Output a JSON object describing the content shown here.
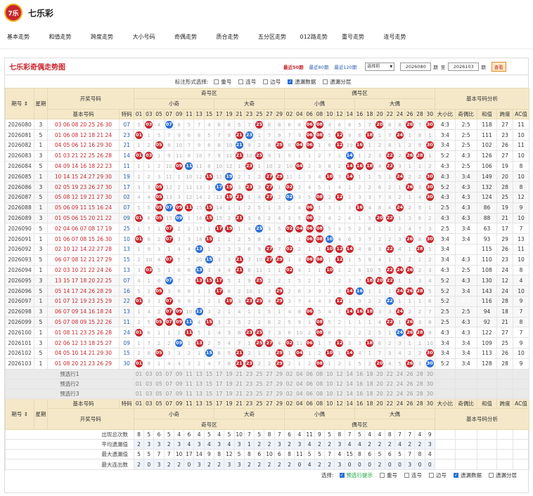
{
  "site": {
    "title": "七乐彩",
    "logo": "7乐"
  },
  "nav": [
    "基本走势",
    "和值走势",
    "跨度走势",
    "大小号码",
    "奇偶走势",
    "质合走势",
    "五分区走势",
    "012路走势",
    "重号走势",
    "连号走势"
  ],
  "panel": {
    "title": "七乐彩奇偶走势图",
    "tabs": [
      "最近50期",
      "最近80期",
      "最近120期"
    ],
    "select": "选择前",
    "from": "2026080",
    "to": "2026103",
    "period": "期",
    "sep": "至",
    "query": "查看"
  },
  "options": {
    "label": "标注形式选择:",
    "items": [
      {
        "l": "重号",
        "on": false
      },
      {
        "l": "连号",
        "on": false
      },
      {
        "l": "边号",
        "on": false
      },
      {
        "l": "遗漏数据",
        "on": true
      },
      {
        "l": "遗漏分层",
        "on": false
      }
    ]
  },
  "header": {
    "issue": "期号",
    "week": "星期",
    "kj": "开奖号码",
    "jz": "奇号区",
    "oz": "偶号区",
    "an": "基本号码分析",
    "basic": "基本号码",
    "special": "特码",
    "xq": "小奇",
    "dq": "大奇",
    "xo": "小偶",
    "do": "大偶",
    "analysis": [
      "大小比",
      "奇偶比",
      "和值",
      "跨度",
      "AC值"
    ]
  },
  "odd": [
    "01",
    "03",
    "05",
    "07",
    "09",
    "11",
    "13",
    "15",
    "17",
    "19",
    "21",
    "23",
    "25",
    "27",
    "29"
  ],
  "even": [
    "02",
    "04",
    "06",
    "08",
    "10",
    "12",
    "14",
    "16",
    "18",
    "20",
    "22",
    "24",
    "26",
    "28",
    "30"
  ],
  "rows": [
    {
      "i": "2026080",
      "w": "3",
      "n": "03 06 08 20 25 26 30",
      "s": "07",
      "a": [
        "4:3",
        "2:5",
        "118",
        "27",
        "11"
      ]
    },
    {
      "i": "2026081",
      "w": "5",
      "n": "01 06 08 12 18 21 24",
      "s": "23",
      "a": [
        "3:4",
        "2:5",
        "111",
        "23",
        "10"
      ]
    },
    {
      "i": "2026082",
      "w": "1",
      "n": "04 05 06 12 16 29 30",
      "s": "21",
      "a": [
        "3:4",
        "2:5",
        "102",
        "26",
        "11"
      ]
    },
    {
      "i": "2026083",
      "w": "3",
      "n": "01 03 21 22 25 26 28",
      "s": "14",
      "a": [
        "5:2",
        "4:3",
        "126",
        "27",
        "10"
      ]
    },
    {
      "i": "2026084",
      "w": "5",
      "n": "04 09 14 16 18 22 23",
      "s": "11",
      "a": [
        "4:3",
        "2:5",
        "106",
        "19",
        "8"
      ]
    },
    {
      "i": "2026085",
      "w": "1",
      "n": "10 14 15 24 27 29 30",
      "s": "19",
      "a": [
        "4:3",
        "3:4",
        "149",
        "20",
        "10"
      ]
    },
    {
      "i": "2026086",
      "w": "3",
      "n": "02 05 19 23 26 27 30",
      "s": "17",
      "a": [
        "5:2",
        "4:3",
        "132",
        "28",
        "8"
      ]
    },
    {
      "i": "2026087",
      "w": "5",
      "n": "05 08 12 19 21 27 30",
      "s": "02",
      "a": [
        "4:3",
        "4:3",
        "124",
        "25",
        "12"
      ]
    },
    {
      "i": "2026088",
      "w": "1",
      "n": "05 06 09 11 15 16 24",
      "s": "07",
      "a": [
        "2:5",
        "4:3",
        "86",
        "19",
        "9"
      ]
    },
    {
      "i": "2026089",
      "w": "3",
      "n": "01 05 06 15 20 21 22",
      "s": "09",
      "a": [
        "4:3",
        "4:3",
        "88",
        "21",
        "10"
      ]
    },
    {
      "i": "2026090",
      "w": "5",
      "n": "02 04 06 07 08 17 19",
      "s": "25",
      "a": [
        "2:5",
        "3:4",
        "63",
        "17",
        "7"
      ]
    },
    {
      "i": "2026091",
      "w": "1",
      "n": "01 06 07 08 15 26 30",
      "s": "10",
      "a": [
        "3:4",
        "3:4",
        "93",
        "29",
        "13"
      ]
    },
    {
      "i": "2026092",
      "w": "3",
      "n": "02 10 12 14 22 27 28",
      "s": "13",
      "a": [
        "3:4",
        "1:6",
        "115",
        "26",
        "11"
      ]
    },
    {
      "i": "2026093",
      "w": "5",
      "n": "06 07 08 12 21 27 29",
      "s": "15",
      "a": [
        "3:4",
        "4:3",
        "110",
        "23",
        "10"
      ]
    },
    {
      "i": "2026094",
      "w": "1",
      "n": "02 03 10 21 22 24 26",
      "s": "13",
      "a": [
        "4:3",
        "2:5",
        "108",
        "24",
        "8"
      ]
    },
    {
      "i": "2026095",
      "w": "3",
      "n": "13 15 17 18 20 22 25",
      "s": "07",
      "a": [
        "5:2",
        "4:3",
        "130",
        "12",
        "4"
      ]
    },
    {
      "i": "2026096",
      "w": "5",
      "n": "05 14 17 24 26 28 29",
      "s": "16",
      "a": [
        "5:2",
        "3:4",
        "143",
        "24",
        "10"
      ]
    },
    {
      "i": "2026097",
      "w": "1",
      "n": "01 07 12 19 23 25 29",
      "s": "22",
      "a": [
        "5:2",
        "6:1",
        "116",
        "28",
        "9"
      ]
    },
    {
      "i": "2026098",
      "w": "3",
      "n": "06 07 09 14 16 18 24",
      "s": "13",
      "a": [
        "2:5",
        "2:5",
        "94",
        "18",
        "7"
      ]
    },
    {
      "i": "2026099",
      "w": "5",
      "n": "05 07 08 09 15 22 26",
      "s": "11",
      "a": [
        "2:5",
        "4:3",
        "92",
        "21",
        "8"
      ]
    },
    {
      "i": "2026100",
      "w": "1",
      "n": "01 08 11 23 25 26 28",
      "s": "24",
      "a": [
        "4:3",
        "4:3",
        "122",
        "27",
        "7"
      ]
    },
    {
      "i": "2026101",
      "w": "3",
      "n": "02 06 12 13 18 25 27",
      "s": "09",
      "a": [
        "3:4",
        "3:4",
        "109",
        "25",
        "9"
      ]
    },
    {
      "i": "2026102",
      "w": "5",
      "n": "04 05 10 14 21 29 30",
      "s": "15",
      "a": [
        "3:4",
        "3:4",
        "113",
        "26",
        "10"
      ]
    },
    {
      "i": "2026103",
      "w": "1",
      "n": "01 08 20 21 23 26 29",
      "s": "30",
      "a": [
        "5:2",
        "3:4",
        "128",
        "28",
        "9"
      ]
    }
  ],
  "pre": [
    "预选行1",
    "预选行2",
    "预选行3"
  ],
  "stats": [
    {
      "l": "出现总次数",
      "v": [
        8,
        5,
        6,
        5,
        4,
        6,
        4,
        5,
        4,
        5,
        10,
        7,
        5,
        8,
        7,
        6,
        4,
        11,
        9,
        5,
        8,
        7,
        5,
        4,
        4,
        8,
        7,
        7,
        4,
        9
      ]
    },
    {
      "l": "平均遗漏值",
      "v": [
        2,
        3,
        3,
        2,
        3,
        4,
        3,
        4,
        3,
        4,
        3,
        1,
        2,
        2,
        3,
        2,
        3,
        4,
        2,
        2,
        3,
        4,
        4,
        2,
        2,
        2,
        4,
        2,
        2,
        3
      ]
    },
    {
      "l": "最大遗漏值",
      "v": [
        5,
        5,
        7,
        7,
        10,
        17,
        14,
        9,
        8,
        12,
        5,
        8,
        6,
        10,
        6,
        8,
        11,
        5,
        5,
        7,
        4,
        15,
        8,
        6,
        5,
        6,
        5,
        7,
        8,
        4
      ]
    },
    {
      "l": "最大连出数",
      "v": [
        2,
        0,
        3,
        2,
        2,
        0,
        3,
        2,
        2,
        3,
        3,
        2,
        2,
        2,
        2,
        2,
        0,
        4,
        2,
        2,
        3,
        0,
        0,
        0,
        2,
        0,
        0,
        3,
        0,
        0
      ]
    }
  ],
  "footer": {
    "label": "选择:",
    "items": [
      {
        "l": "预选行提示",
        "on": true,
        "c": "grn"
      },
      {
        "l": "重号",
        "on": false
      },
      {
        "l": "连号",
        "on": false
      },
      {
        "l": "边号",
        "on": false
      },
      {
        "l": "遗漏数据",
        "on": true
      },
      {
        "l": "遗漏分层",
        "on": false
      }
    ]
  }
}
